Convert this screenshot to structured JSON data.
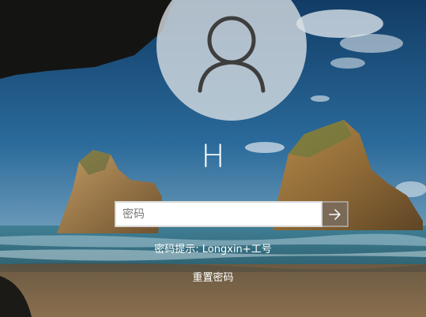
{
  "user": {
    "avatar_icon": "user-silhouette-icon",
    "name": "H"
  },
  "password": {
    "placeholder": "密码",
    "value": "",
    "submit_icon": "arrow-right-icon"
  },
  "hint": {
    "text": "密码提示: Longxin+工号"
  },
  "reset": {
    "label": "重置密码"
  },
  "colors": {
    "sky": "#1d4f7c",
    "input_border": "#d9d9d9",
    "text": "#ffffff"
  }
}
